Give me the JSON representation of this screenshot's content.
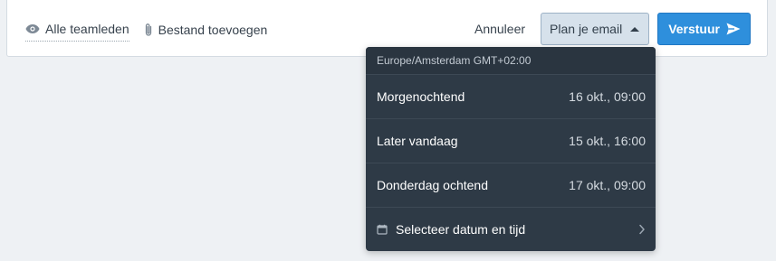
{
  "toolbar": {
    "visibility_label": "Alle teamleden",
    "attach_label": "Bestand toevoegen",
    "cancel_label": "Annuleer",
    "schedule_label": "Plan je email",
    "send_label": "Verstuur"
  },
  "schedule_menu": {
    "timezone": "Europe/Amsterdam GMT+02:00",
    "options": [
      {
        "label": "Morgenochtend",
        "when": "16 okt., 09:00"
      },
      {
        "label": "Later vandaag",
        "when": "15 okt., 16:00"
      },
      {
        "label": "Donderdag ochtend",
        "when": "17 okt., 09:00"
      }
    ],
    "custom_label": "Selecteer datum en tijd"
  },
  "icons": {
    "visibility": "eye-icon",
    "attach": "paperclip-icon",
    "schedule_caret": "caret-up-icon",
    "send": "paper-plane-icon",
    "calendar": "calendar-icon",
    "chevron": "chevron-right-icon"
  },
  "colors": {
    "primary": "#2e8fdc",
    "menu_bg": "#2e3a46",
    "schedule_button_bg": "#d6e1eb"
  }
}
